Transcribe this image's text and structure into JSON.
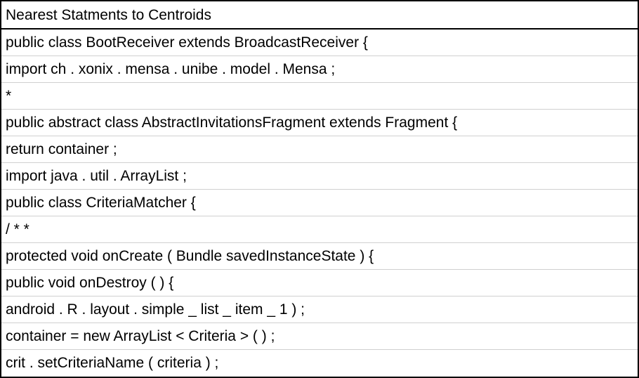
{
  "table": {
    "header": "Nearest Statments to Centroids",
    "rows": [
      "public class BootReceiver extends BroadcastReceiver {",
      "import ch . xonix . mensa . unibe . model . Mensa ;",
      "*",
      "public abstract class AbstractInvitationsFragment extends Fragment {",
      "return container ;",
      "import java . util . ArrayList ;",
      "public class CriteriaMatcher {",
      "/ * *",
      "protected void onCreate ( Bundle savedInstanceState ) {",
      "public void onDestroy ( ) {",
      "android . R . layout . simple _ list _ item _ 1 ) ;",
      "container = new ArrayList < Criteria > ( ) ;",
      "crit . setCriteriaName ( criteria ) ;"
    ]
  }
}
